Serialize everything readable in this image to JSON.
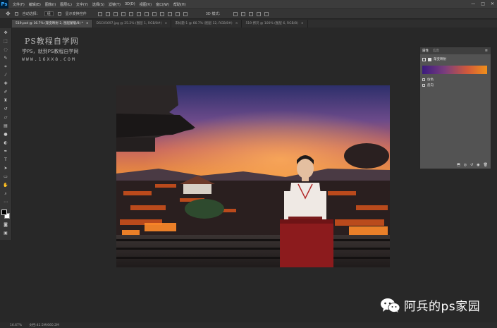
{
  "app": {
    "logo": "Ps",
    "menu": [
      "文件(F)",
      "编辑(E)",
      "图像(I)",
      "图层(L)",
      "文字(Y)",
      "选择(S)",
      "滤镜(T)",
      "3D(D)",
      "视图(V)",
      "窗口(W)",
      "帮助(H)"
    ],
    "window_controls": [
      "—",
      "□",
      "✕"
    ]
  },
  "options": {
    "auto_select_label": "自动选择：",
    "auto_select_value": "组",
    "show_transform_label": "显示变换控件",
    "mode_3d_label": "3D 模式："
  },
  "tabs": [
    {
      "label": "519.psd @ 16.7% (渐变映射 2, 图层蒙版/8) *",
      "active": true
    },
    {
      "label": "DSC05697.jpg @ 25.2% (图层 1, RGB/8#)",
      "active": false
    },
    {
      "label": "未标题-1 @ 66.7% (图层 12, RGB/8#)",
      "active": false
    },
    {
      "label": "519 拷贝 @ 100% (图层 6, RGB/8)",
      "active": false
    }
  ],
  "watermark": {
    "title": "PS教程自学网",
    "subtitle": "学PS，就到PS教程自学网",
    "url": "WWW.16XX8.COM"
  },
  "properties_panel": {
    "tab_properties": "属性",
    "tab_info": "信息",
    "adjustment_name": "渐变映射",
    "gradient_colors": [
      "#3b1b7e",
      "#7a3e7d",
      "#d25a3a",
      "#f0901a"
    ],
    "option_dither": "仿色",
    "option_reverse": "反向"
  },
  "status_bar": {
    "zoom": "16.67%",
    "doc_info": "文档:41.5M/660.2M"
  },
  "brand": {
    "text": "阿兵的ps家园",
    "icon": "wechat-icon"
  }
}
